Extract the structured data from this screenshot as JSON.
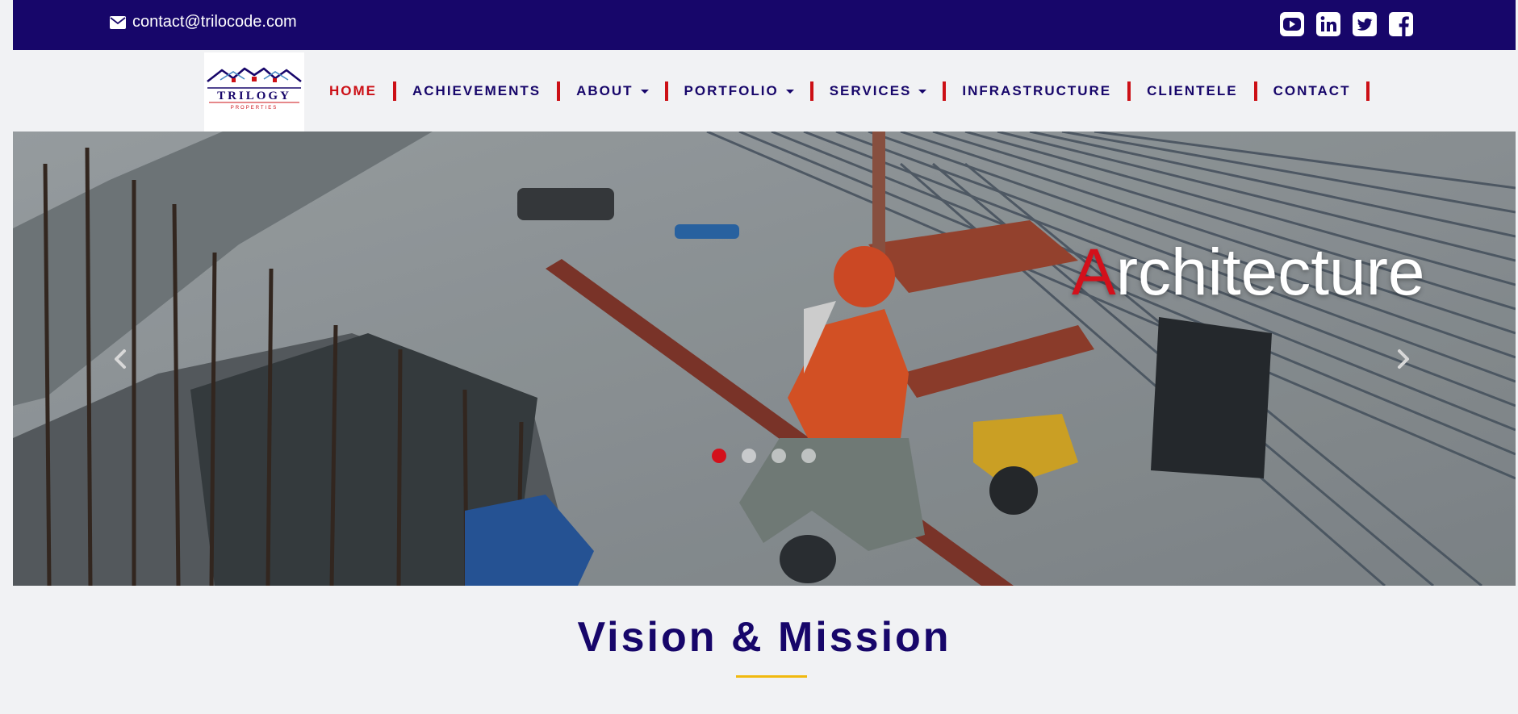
{
  "topbar": {
    "email": "contact@trilocode.com",
    "icons": [
      "envelope-icon",
      "youtube-icon",
      "linkedin-icon",
      "twitter-icon",
      "facebook-icon"
    ]
  },
  "logo": {
    "text": "TRILOGY",
    "subtext": "PROPERTIES"
  },
  "nav": {
    "items": [
      {
        "label": "HOME",
        "active": true,
        "dropdown": false
      },
      {
        "label": "ACHIEVEMENTS",
        "active": false,
        "dropdown": false
      },
      {
        "label": "ABOUT",
        "active": false,
        "dropdown": true
      },
      {
        "label": "PORTFOLIO",
        "active": false,
        "dropdown": true
      },
      {
        "label": "SERVICES",
        "active": false,
        "dropdown": true
      },
      {
        "label": "INFRASTRUCTURE",
        "active": false,
        "dropdown": false
      },
      {
        "label": "CLIENTELE",
        "active": false,
        "dropdown": false
      },
      {
        "label": "CONTACT",
        "active": false,
        "dropdown": false
      }
    ]
  },
  "hero": {
    "caption_first": "A",
    "caption_rest": "rchitecture",
    "slides": 4,
    "active_slide": 1
  },
  "section": {
    "title": "Vision & Mission"
  },
  "colors": {
    "navy": "#17066a",
    "red": "#cc1016",
    "gold": "#f1b90f",
    "background": "#f1f2f4"
  }
}
